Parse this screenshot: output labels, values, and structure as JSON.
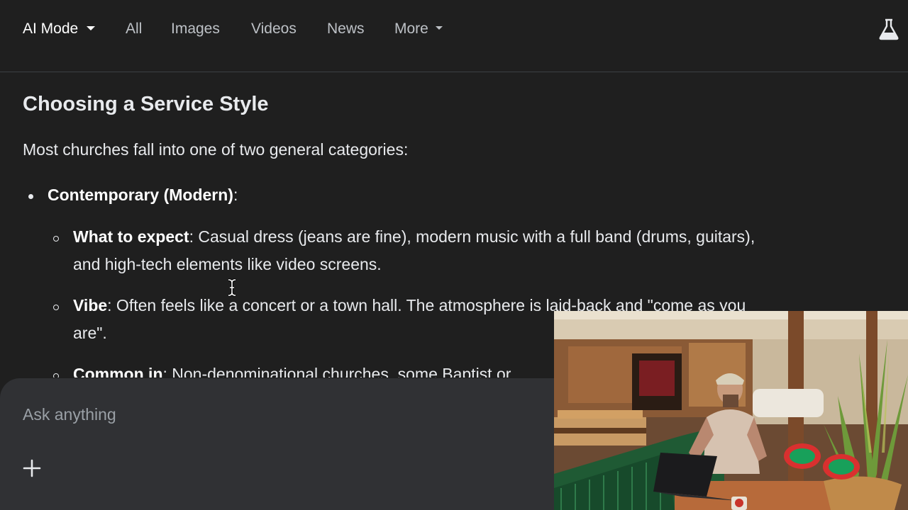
{
  "nav": {
    "tabs": [
      {
        "label": "AI Mode",
        "active": true,
        "dropdown": true
      },
      {
        "label": "All",
        "active": false,
        "dropdown": false
      },
      {
        "label": "Images",
        "active": false,
        "dropdown": false
      },
      {
        "label": "Videos",
        "active": false,
        "dropdown": false
      },
      {
        "label": "News",
        "active": false,
        "dropdown": false
      },
      {
        "label": "More",
        "active": false,
        "dropdown": true
      }
    ],
    "labs_icon": "flask-icon"
  },
  "content": {
    "heading": "Choosing a Service Style",
    "intro": "Most churches fall into one of two general categories:",
    "item": {
      "title": "Contemporary (Modern)",
      "suffix": ":",
      "subitems": [
        {
          "term": "What to expect",
          "text": ": Casual dress (jeans are fine), modern music with a full band (drums, guitars), and high-tech elements like video screens."
        },
        {
          "term": "Vibe",
          "text": ": Often feels like a concert or a town hall. The atmosphere is laid-back and \"come as you are\"."
        },
        {
          "term": "Common in",
          "text": ": Non-denominational churches, some Baptist or"
        }
      ]
    }
  },
  "ask": {
    "placeholder": "Ask anything",
    "plus_icon": "plus-icon"
  },
  "colors": {
    "background": "#1f1f1f",
    "askbar": "#303134",
    "text": "#e8eaed",
    "muted": "#9aa0a6"
  }
}
